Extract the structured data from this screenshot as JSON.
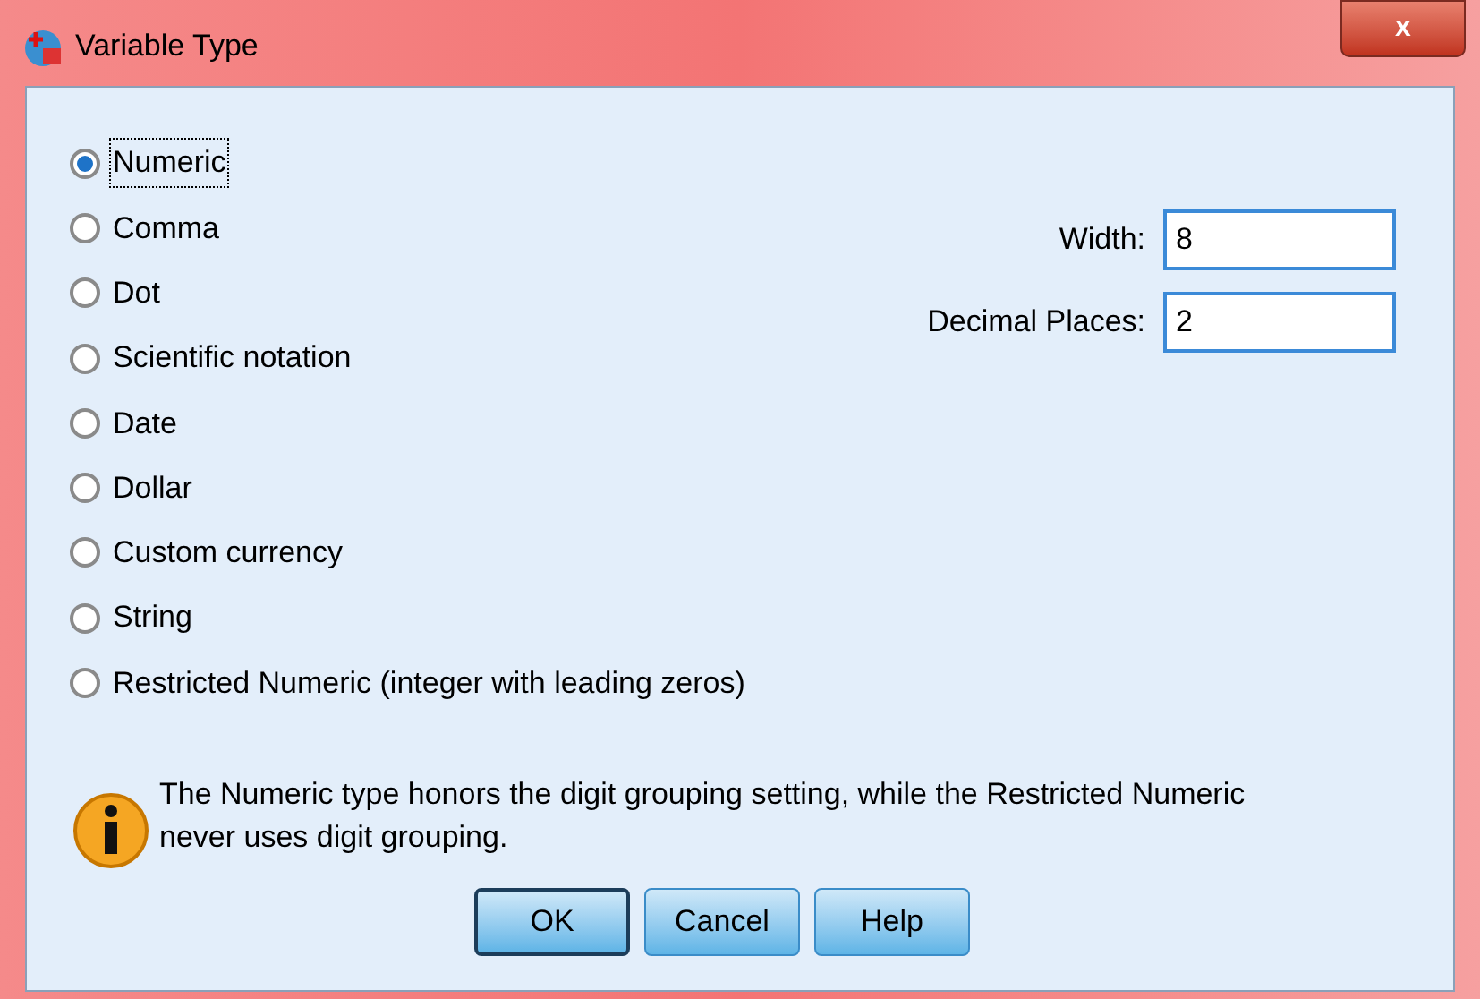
{
  "window": {
    "title": "Variable Type",
    "close_label": "x"
  },
  "types": [
    {
      "label": "Numeric",
      "selected": true
    },
    {
      "label": "Comma",
      "selected": false
    },
    {
      "label": "Dot",
      "selected": false
    },
    {
      "label": "Scientific notation",
      "selected": false
    },
    {
      "label": "Date",
      "selected": false
    },
    {
      "label": "Dollar",
      "selected": false
    },
    {
      "label": "Custom currency",
      "selected": false
    },
    {
      "label": "String",
      "selected": false
    },
    {
      "label": "Restricted Numeric (integer with leading zeros)",
      "selected": false
    }
  ],
  "fields": [
    {
      "label": "Width:",
      "value": "8"
    },
    {
      "label": "Decimal Places:",
      "value": "2"
    }
  ],
  "info": "The Numeric type honors the digit grouping setting, while the Restricted Numeric never uses digit grouping.",
  "buttons": [
    {
      "label": "OK",
      "default": true
    },
    {
      "label": "Cancel",
      "default": false
    },
    {
      "label": "Help",
      "default": false
    }
  ]
}
